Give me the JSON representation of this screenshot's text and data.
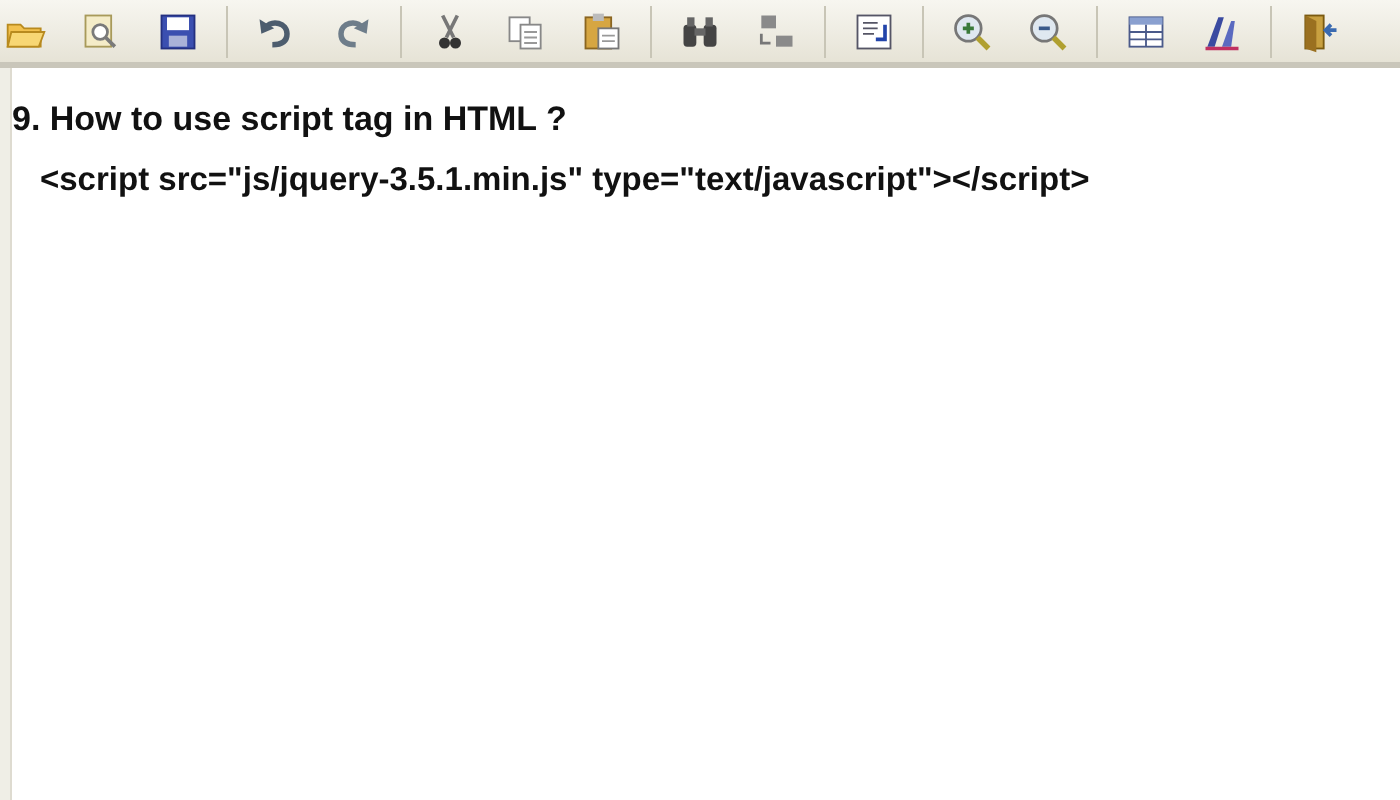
{
  "content": {
    "heading": "9. How to use script tag in HTML ?",
    "code": "<script src=\"js/jquery-3.5.1.min.js\" type=\"text/javascript\"></script>"
  }
}
